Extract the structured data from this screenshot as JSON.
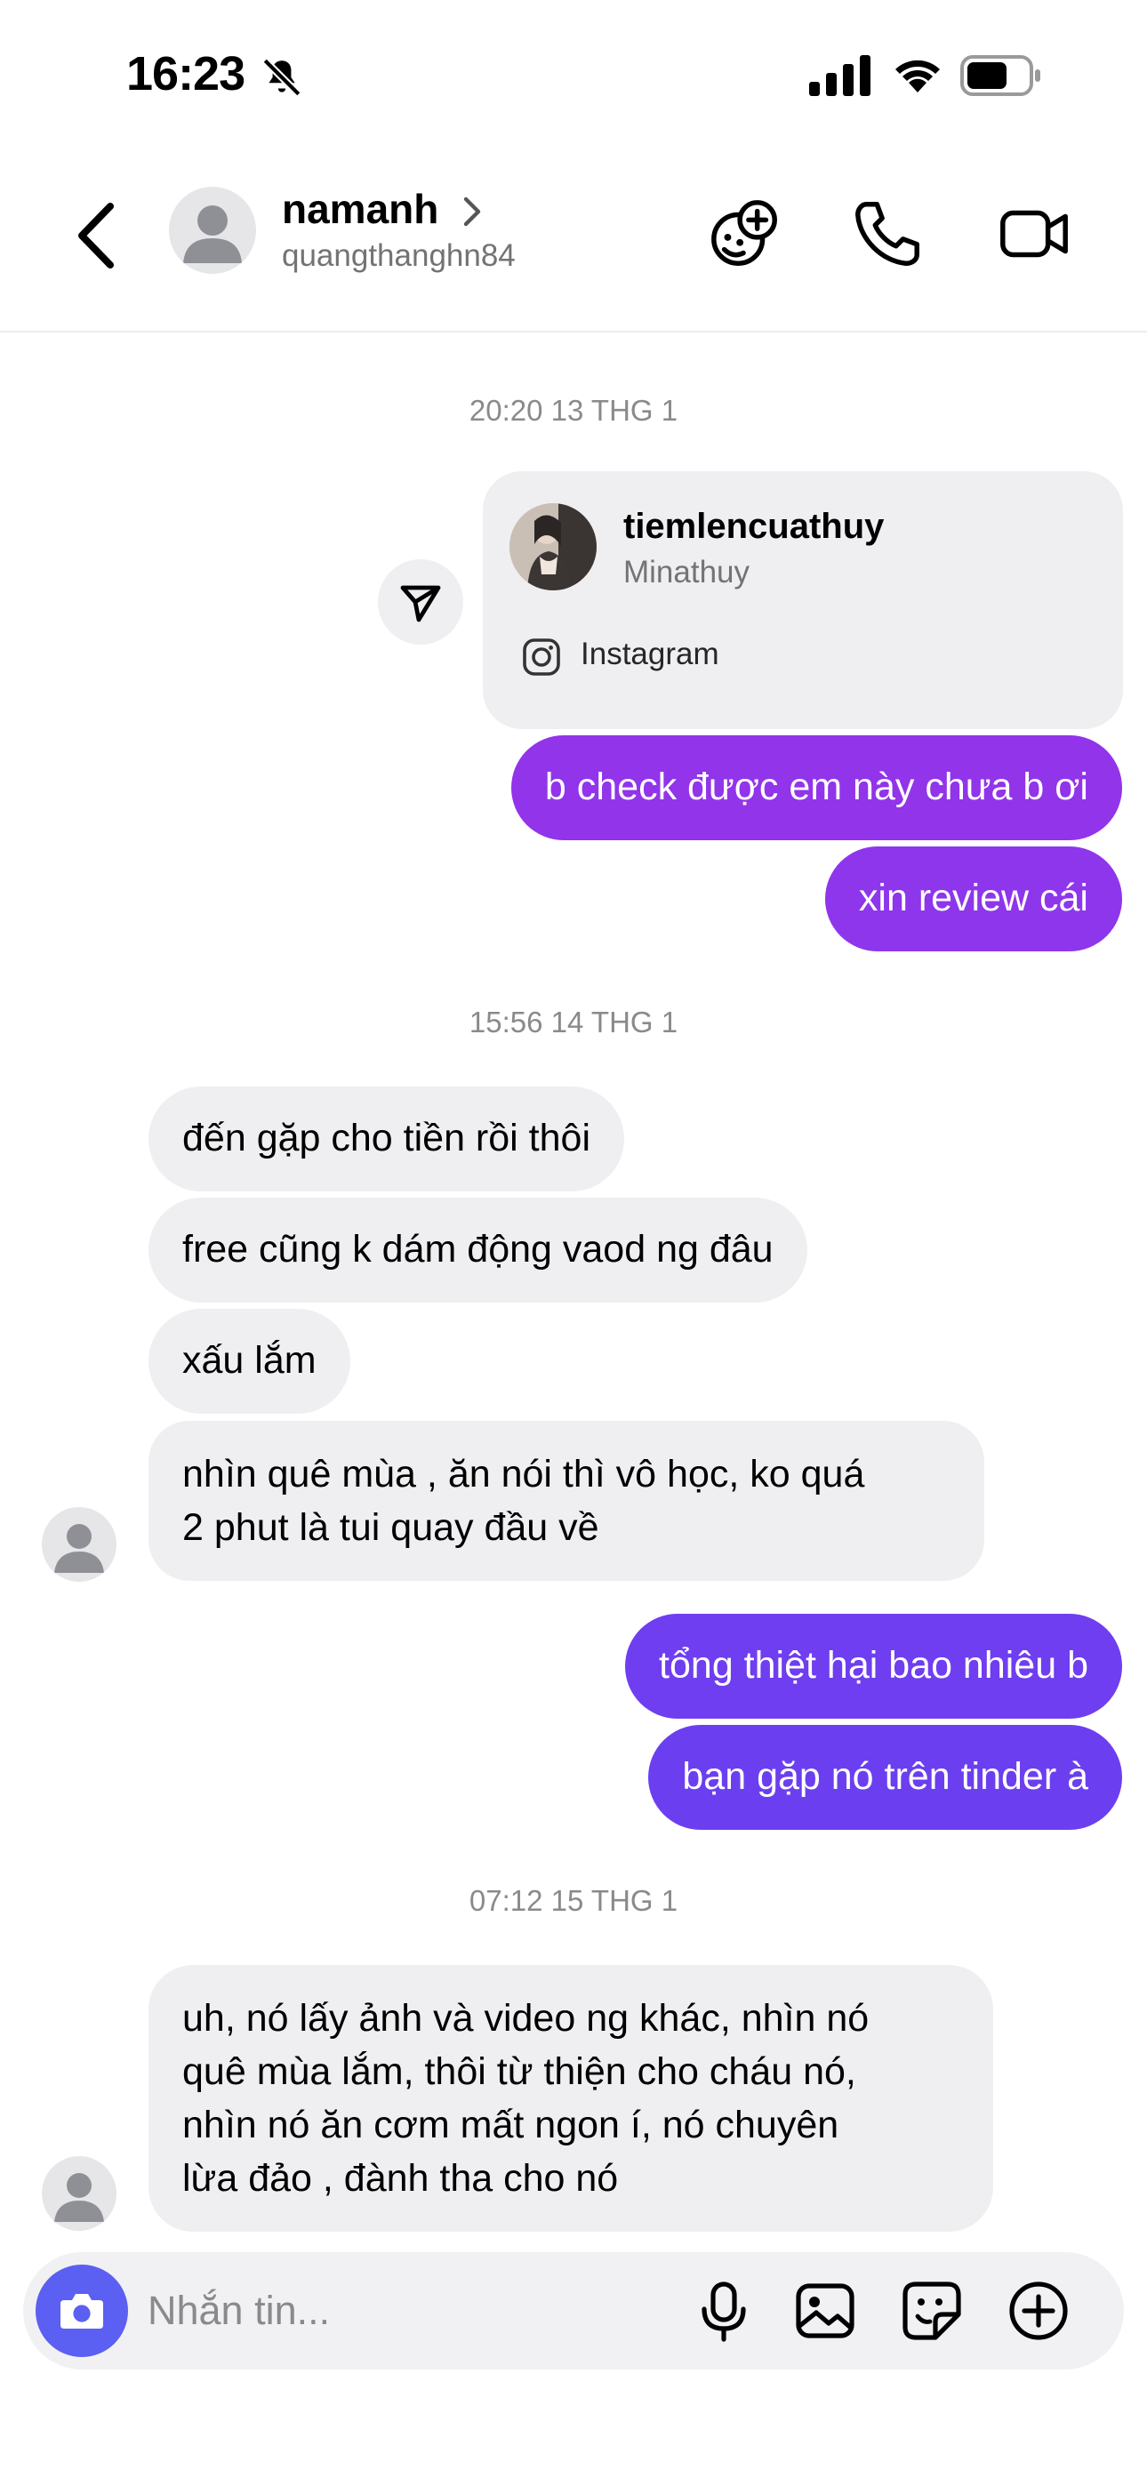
{
  "status_bar": {
    "time": "16:23"
  },
  "header": {
    "name": "namanh",
    "username": "quangthanghn84"
  },
  "conversation": {
    "timestamps": [
      "20:20 13 THG 1",
      "15:56 14 THG 1",
      "07:12 15 THG 1"
    ],
    "shared_profile": {
      "username": "tiemlencuathuy",
      "display_name": "Minathuy",
      "source": "Instagram"
    },
    "messages": [
      {
        "from": "me",
        "text": "b check được em này chưa b ơi"
      },
      {
        "from": "me",
        "text": "xin review cái"
      },
      {
        "from": "them",
        "text": "đến gặp cho tiền rồi thôi"
      },
      {
        "from": "them",
        "text": "free cũng k dám động vaod ng đâu"
      },
      {
        "from": "them",
        "text": "xấu lắm"
      },
      {
        "from": "them",
        "lines": [
          "nhìn quê mùa , ăn nói thì vô học, ko quá",
          "2 phut là tui quay đầu về"
        ]
      },
      {
        "from": "me",
        "text": "tổng thiệt hại bao nhiêu b"
      },
      {
        "from": "me",
        "text": "bạn gặp nó trên tinder à"
      },
      {
        "from": "them",
        "lines": [
          "uh, nó lấy ảnh và video ng khác, nhìn nó",
          "quê mùa lắm, thôi từ thiện cho cháu nó,",
          "nhìn nó ăn cơm mất ngon í, nó chuyên",
          "lừa đảo , đành tha cho nó"
        ]
      }
    ]
  },
  "composer": {
    "placeholder": "Nhắn tin..."
  },
  "colors": {
    "outgoing_bubble_top": "#9333ea",
    "outgoing_bubble_bottom": "#6d3ef0",
    "incoming_bubble": "#efeff1",
    "camera_button": "#5b5ff2"
  },
  "icons": [
    "mute-icon",
    "signal-icon",
    "wifi-icon",
    "battery-icon",
    "back-icon",
    "chevron-right-icon",
    "game-icon",
    "phone-icon",
    "video-icon",
    "forward-icon",
    "instagram-icon",
    "camera-icon",
    "microphone-icon",
    "gallery-icon",
    "sticker-icon",
    "plus-icon"
  ]
}
